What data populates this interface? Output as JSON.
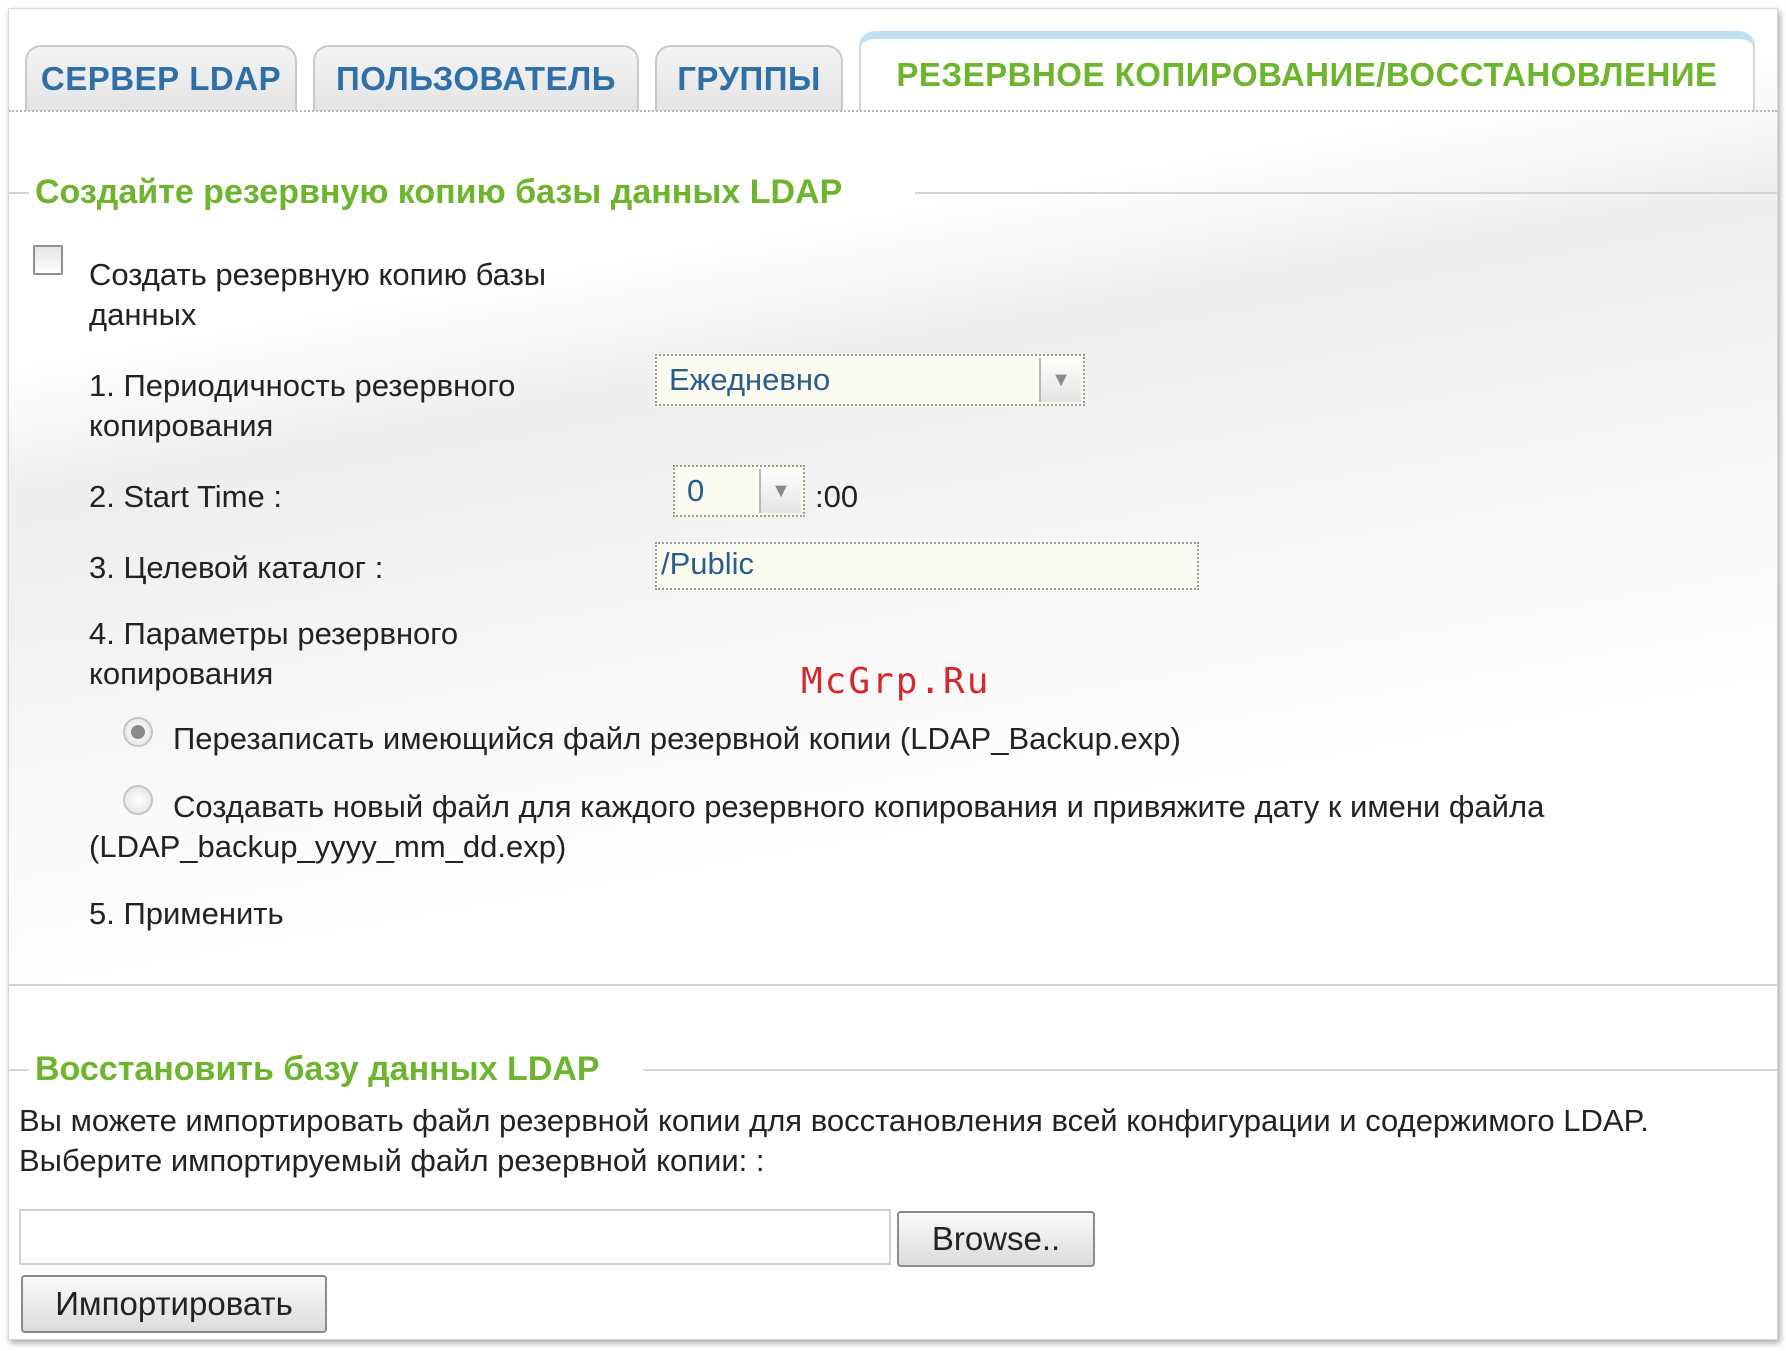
{
  "tabs": [
    {
      "label": "СЕРВЕР LDAP"
    },
    {
      "label": "ПОЛЬЗОВАТЕЛЬ"
    },
    {
      "label": "ГРУППЫ"
    },
    {
      "label": "РЕЗЕРВНОЕ КОПИРОВАНИЕ/ВОССТАНОВЛЕНИЕ",
      "active": true
    }
  ],
  "backup": {
    "title": "Создайте резервную копию базы данных LDAP",
    "enable_label_line1": "Создать резервную копию базы",
    "enable_label_line2": "данных",
    "enable_checked": false,
    "frequency": {
      "label_line1": "1. Периодичность резервного",
      "label_line2": "копирования",
      "value": "Ежедневно"
    },
    "start_time": {
      "label": "2. Start Time :",
      "hour": "0",
      "suffix": ":00"
    },
    "target": {
      "label": "3. Целевой каталог :",
      "value": "/Public"
    },
    "options": {
      "label_line1": "4. Параметры резервного",
      "label_line2": "копирования",
      "overwrite": "Перезаписать имеющийся файл резервной копии (LDAP_Backup.exp)",
      "new_file_line1": "Создавать новый файл для каждого резервного копирования и привяжите дату к имени файла",
      "new_file_line2": "(LDAP_backup_yyyy_mm_dd.exp)",
      "selected": "overwrite"
    },
    "apply_label": "5. Применить"
  },
  "restore": {
    "title": "Восстановить базу данных LDAP",
    "description": "Вы можете импортировать файл резервной копии для восстановления всей конфигурации и содержимого LDAP.",
    "select_label": "Выберите импортируемый файл резервной копии: :",
    "file_value": "",
    "browse_label": "Browse..",
    "import_label": "Импортировать"
  },
  "watermark": "McGrp.Ru"
}
